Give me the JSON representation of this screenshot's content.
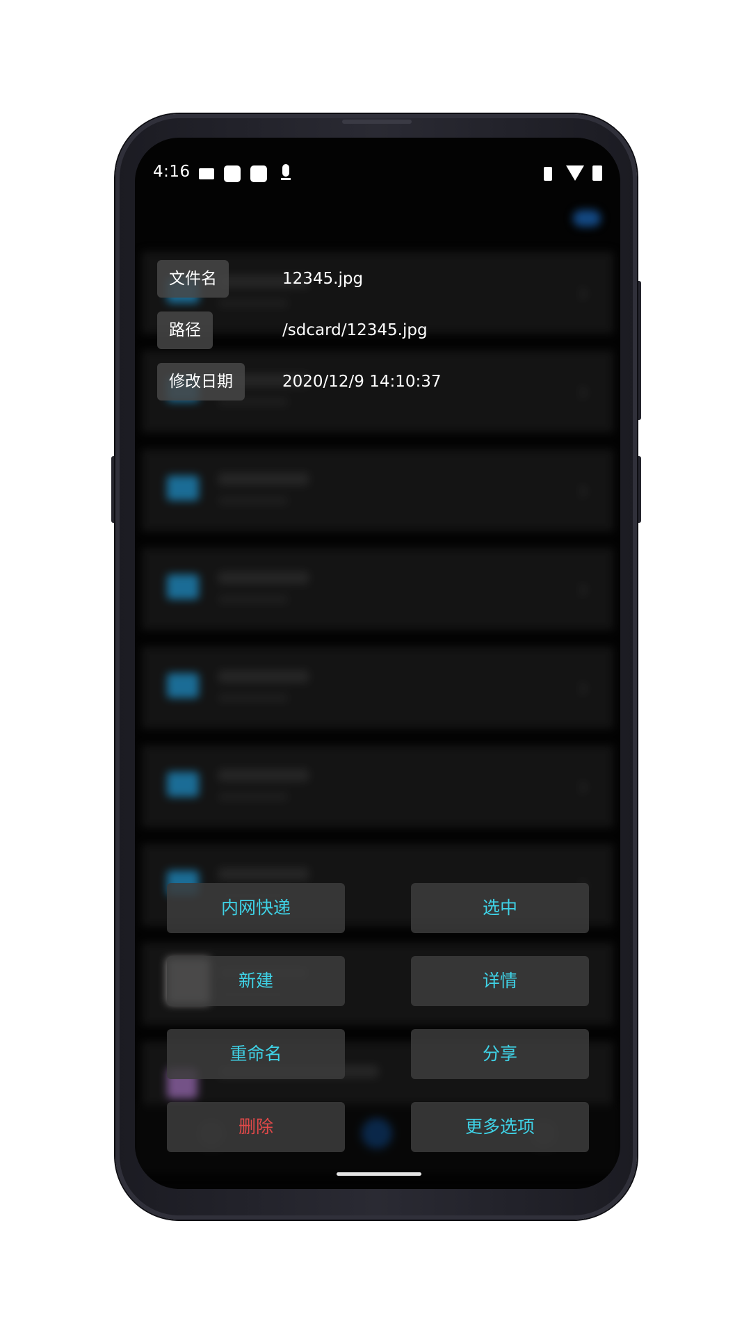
{
  "status_bar": {
    "time": "4:16",
    "icons": [
      "folder-icon",
      "app-square-icon",
      "app-square-icon",
      "microphone-icon",
      "vibrate-icon",
      "wifi-off-icon",
      "battery-icon"
    ]
  },
  "details": [
    {
      "label": "文件名",
      "value": "12345.jpg"
    },
    {
      "label": "路径",
      "value": "/sdcard/12345.jpg"
    },
    {
      "label": "修改日期",
      "value": "2020/12/9 14:10:37"
    }
  ],
  "actions": {
    "lan_transfer": "内网快递",
    "select": "选中",
    "new": "新建",
    "details": "详情",
    "rename": "重命名",
    "share": "分享",
    "delete": "删除",
    "more_options": "更多选项"
  },
  "colors": {
    "action_text": "#3fd2e6",
    "danger_text": "#e14949",
    "folder_icon": "#2aa7e6",
    "screen_background": "#050505"
  }
}
